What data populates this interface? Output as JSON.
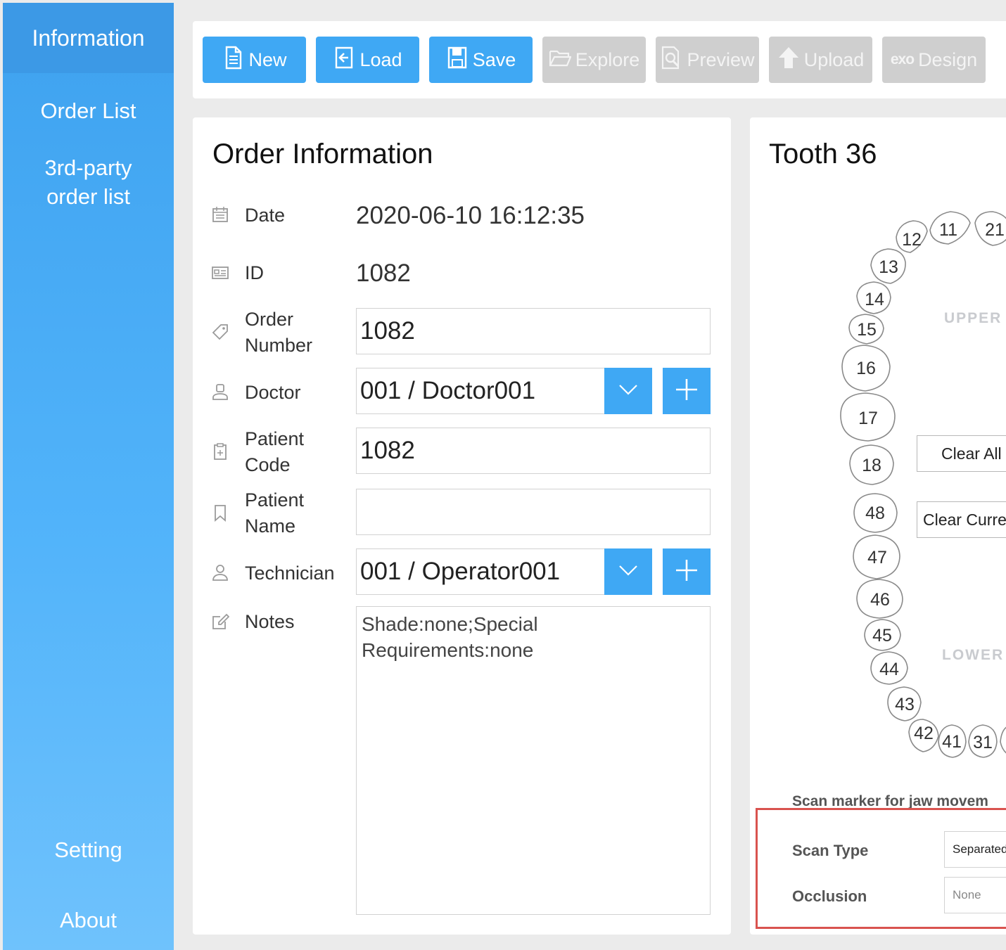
{
  "sidebar": {
    "items": [
      {
        "label": "Information"
      },
      {
        "label": "Order List"
      },
      {
        "label": "3rd-party order list"
      },
      {
        "label": "Setting"
      },
      {
        "label": "About"
      }
    ]
  },
  "toolbar": {
    "new_label": "New",
    "load_label": "Load",
    "save_label": "Save",
    "explore_label": "Explore",
    "preview_label": "Preview",
    "upload_label": "Upload",
    "design_brand": "exo",
    "design_label": "Design"
  },
  "order": {
    "title": "Order Information",
    "date_label": "Date",
    "date_value": "2020-06-10 16:12:35",
    "id_label": "ID",
    "id_value": "1082",
    "order_number_label_1": "Order",
    "order_number_label_2": "Number",
    "order_number_value": "1082",
    "doctor_label": "Doctor",
    "doctor_value": "001 / Doctor001",
    "patient_code_label_1": "Patient",
    "patient_code_label_2": "Code",
    "patient_code_value": "1082",
    "patient_name_label_1": "Patient",
    "patient_name_label_2": "Name",
    "patient_name_value": "",
    "technician_label": "Technician",
    "technician_value": "001 / Operator001",
    "notes_label": "Notes",
    "notes_line_1": "Shade:none;Special",
    "notes_line_2": "Requirements:none"
  },
  "tooth": {
    "title": "Tooth 36",
    "upper_label": "UPPER",
    "lower_label": "LOWER",
    "upper_teeth": [
      "12",
      "11",
      "21",
      "13",
      "14",
      "15",
      "16",
      "17",
      "18"
    ],
    "lower_teeth": [
      "48",
      "47",
      "46",
      "45",
      "44",
      "43",
      "42",
      "41",
      "31"
    ],
    "clear_all_label": "Clear All",
    "clear_current_label": "Clear Curre",
    "scan_marker_label": "Scan marker for jaw movem",
    "scan_type_label": "Scan Type",
    "scan_type_value": "Separated",
    "occlusion_label": "Occlusion",
    "occlusion_value": "None"
  },
  "colors": {
    "accent": "#3fa8f4",
    "sidebar_active": "#3c99e6",
    "disabled": "#cfcfcf",
    "highlight_border": "#d9534f"
  },
  "icons": {
    "new": "document-icon",
    "load": "import-icon",
    "save": "floppy-icon",
    "explore": "folder-open-icon",
    "preview": "preview-icon",
    "upload": "upload-arrow-icon",
    "date": "calendar-icon",
    "id": "id-card-icon",
    "order_number": "tag-icon",
    "doctor": "doctor-icon",
    "patient_code": "clipboard-icon",
    "patient_name": "bookmark-icon",
    "technician": "user-icon",
    "notes": "edit-icon"
  }
}
